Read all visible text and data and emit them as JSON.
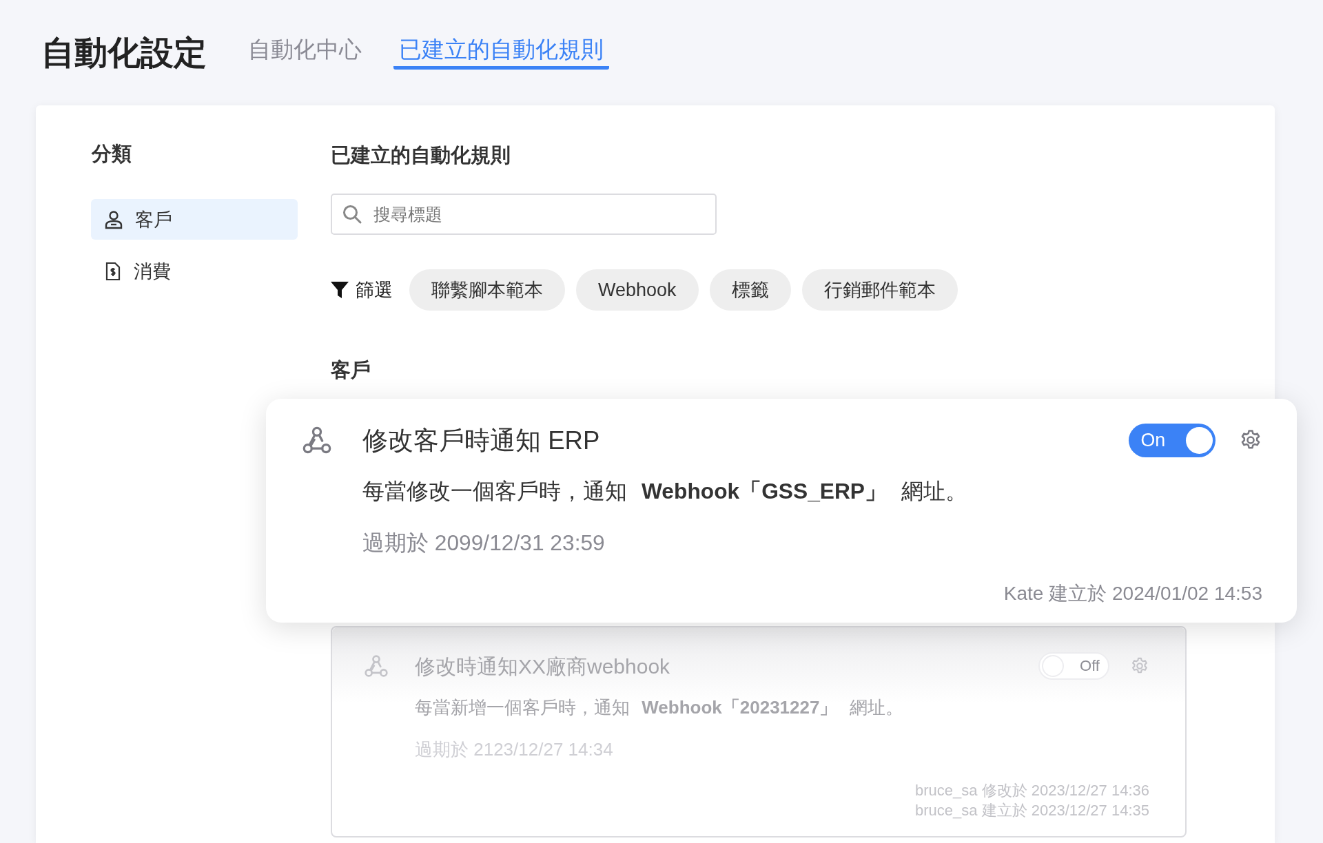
{
  "header": {
    "title": "自動化設定",
    "tabs": [
      {
        "label": "自動化中心",
        "selected": false
      },
      {
        "label": "已建立的自動化規則",
        "selected": true
      }
    ]
  },
  "sidebar": {
    "title": "分類",
    "items": [
      {
        "label": "客戶",
        "kind": "customer",
        "selected": true
      },
      {
        "label": "消費",
        "kind": "spending",
        "selected": false
      }
    ]
  },
  "content": {
    "title": "已建立的自動化規則",
    "search": {
      "placeholder": "搜尋標題"
    },
    "filter": {
      "label": "篩選",
      "chips": [
        {
          "label": "聯繫腳本範本",
          "selected": false
        },
        {
          "label": "Webhook",
          "selected": false
        },
        {
          "label": "標籤",
          "selected": false
        },
        {
          "label": "行銷郵件範本",
          "selected": false
        }
      ]
    },
    "section": {
      "title": "客戶",
      "rules": [
        {
          "title": "修改客戶時通知 ERP",
          "description": "每當修改一個客戶時，通知 **Webhook「GSS_ERP」** 網址。",
          "expiry": "過期於 2099/12/31 23:59",
          "toggle_label": "On",
          "on": true,
          "floating": true,
          "meta": [
            "Kate 建立於 2024/01/02 14:53"
          ]
        },
        {
          "title": "修改時通知XX廠商webhook",
          "description": "每當新增一個客戶時，通知 **Webhook「20231227」** 網址。",
          "expiry": "過期於 2123/12/27 14:34",
          "toggle_label": "Off",
          "on": false,
          "floating": false,
          "meta": [
            "bruce_sa 修改於 2023/12/27 14:36",
            "bruce_sa 建立於 2023/12/27 14:35"
          ]
        }
      ]
    }
  }
}
